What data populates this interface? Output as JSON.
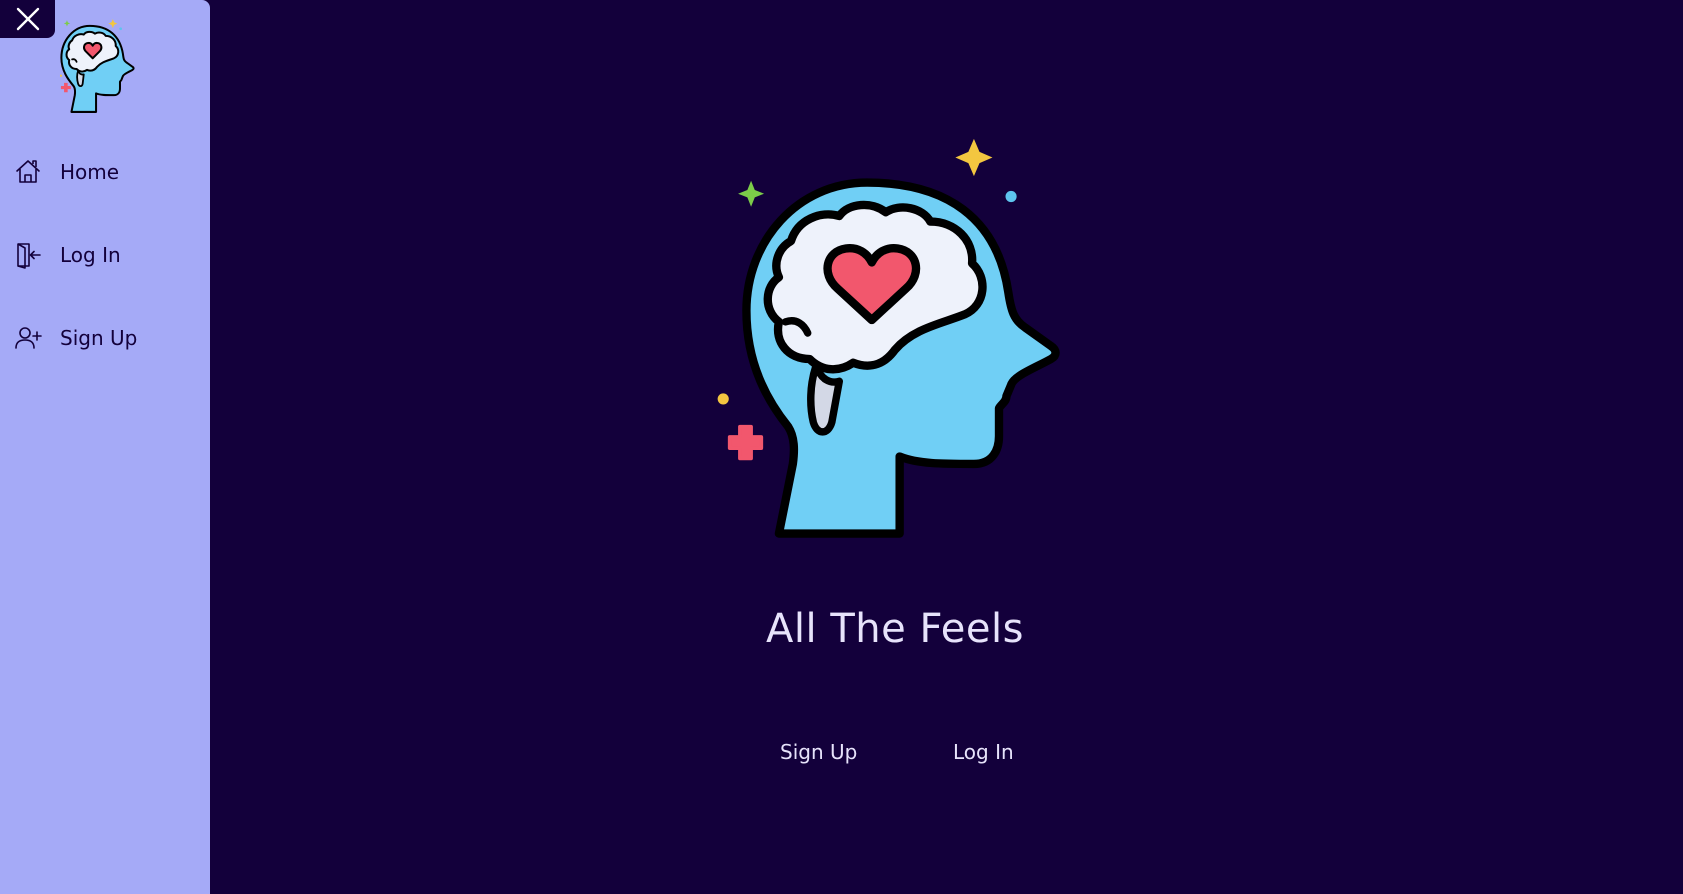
{
  "app": {
    "title": "All The Feels"
  },
  "sidebar": {
    "close_icon": "close-icon",
    "logo_icon": "head-brain-heart-icon",
    "items": [
      {
        "label": "Home",
        "icon": "home-icon"
      },
      {
        "label": "Log In",
        "icon": "login-door-icon"
      },
      {
        "label": "Sign Up",
        "icon": "add-user-icon"
      }
    ]
  },
  "main": {
    "logo_icon": "head-brain-heart-icon",
    "title": "All The Feels",
    "buttons": {
      "signup_label": "Sign Up",
      "login_label": "Log In"
    }
  },
  "colors": {
    "background": "#13003b",
    "sidebar": "#a5aaf7",
    "head": "#70cff5",
    "brain": "#eef2fb",
    "heart": "#f2576d",
    "text_light": "#e7e3fb"
  }
}
